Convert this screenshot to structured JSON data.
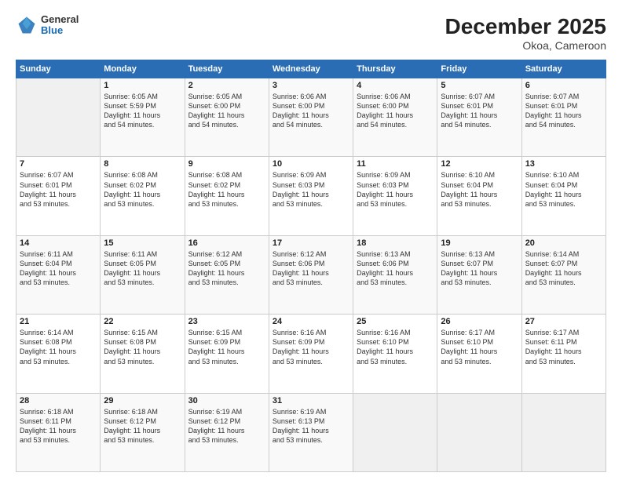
{
  "header": {
    "logo_general": "General",
    "logo_blue": "Blue",
    "title": "December 2025",
    "subtitle": "Okoa, Cameroon"
  },
  "columns": [
    "Sunday",
    "Monday",
    "Tuesday",
    "Wednesday",
    "Thursday",
    "Friday",
    "Saturday"
  ],
  "weeks": [
    [
      {
        "day": "",
        "info": ""
      },
      {
        "day": "1",
        "info": "Sunrise: 6:05 AM\nSunset: 5:59 PM\nDaylight: 11 hours\nand 54 minutes."
      },
      {
        "day": "2",
        "info": "Sunrise: 6:05 AM\nSunset: 6:00 PM\nDaylight: 11 hours\nand 54 minutes."
      },
      {
        "day": "3",
        "info": "Sunrise: 6:06 AM\nSunset: 6:00 PM\nDaylight: 11 hours\nand 54 minutes."
      },
      {
        "day": "4",
        "info": "Sunrise: 6:06 AM\nSunset: 6:00 PM\nDaylight: 11 hours\nand 54 minutes."
      },
      {
        "day": "5",
        "info": "Sunrise: 6:07 AM\nSunset: 6:01 PM\nDaylight: 11 hours\nand 54 minutes."
      },
      {
        "day": "6",
        "info": "Sunrise: 6:07 AM\nSunset: 6:01 PM\nDaylight: 11 hours\nand 54 minutes."
      }
    ],
    [
      {
        "day": "7",
        "info": "Sunrise: 6:07 AM\nSunset: 6:01 PM\nDaylight: 11 hours\nand 53 minutes."
      },
      {
        "day": "8",
        "info": "Sunrise: 6:08 AM\nSunset: 6:02 PM\nDaylight: 11 hours\nand 53 minutes."
      },
      {
        "day": "9",
        "info": "Sunrise: 6:08 AM\nSunset: 6:02 PM\nDaylight: 11 hours\nand 53 minutes."
      },
      {
        "day": "10",
        "info": "Sunrise: 6:09 AM\nSunset: 6:03 PM\nDaylight: 11 hours\nand 53 minutes."
      },
      {
        "day": "11",
        "info": "Sunrise: 6:09 AM\nSunset: 6:03 PM\nDaylight: 11 hours\nand 53 minutes."
      },
      {
        "day": "12",
        "info": "Sunrise: 6:10 AM\nSunset: 6:04 PM\nDaylight: 11 hours\nand 53 minutes."
      },
      {
        "day": "13",
        "info": "Sunrise: 6:10 AM\nSunset: 6:04 PM\nDaylight: 11 hours\nand 53 minutes."
      }
    ],
    [
      {
        "day": "14",
        "info": "Sunrise: 6:11 AM\nSunset: 6:04 PM\nDaylight: 11 hours\nand 53 minutes."
      },
      {
        "day": "15",
        "info": "Sunrise: 6:11 AM\nSunset: 6:05 PM\nDaylight: 11 hours\nand 53 minutes."
      },
      {
        "day": "16",
        "info": "Sunrise: 6:12 AM\nSunset: 6:05 PM\nDaylight: 11 hours\nand 53 minutes."
      },
      {
        "day": "17",
        "info": "Sunrise: 6:12 AM\nSunset: 6:06 PM\nDaylight: 11 hours\nand 53 minutes."
      },
      {
        "day": "18",
        "info": "Sunrise: 6:13 AM\nSunset: 6:06 PM\nDaylight: 11 hours\nand 53 minutes."
      },
      {
        "day": "19",
        "info": "Sunrise: 6:13 AM\nSunset: 6:07 PM\nDaylight: 11 hours\nand 53 minutes."
      },
      {
        "day": "20",
        "info": "Sunrise: 6:14 AM\nSunset: 6:07 PM\nDaylight: 11 hours\nand 53 minutes."
      }
    ],
    [
      {
        "day": "21",
        "info": "Sunrise: 6:14 AM\nSunset: 6:08 PM\nDaylight: 11 hours\nand 53 minutes."
      },
      {
        "day": "22",
        "info": "Sunrise: 6:15 AM\nSunset: 6:08 PM\nDaylight: 11 hours\nand 53 minutes."
      },
      {
        "day": "23",
        "info": "Sunrise: 6:15 AM\nSunset: 6:09 PM\nDaylight: 11 hours\nand 53 minutes."
      },
      {
        "day": "24",
        "info": "Sunrise: 6:16 AM\nSunset: 6:09 PM\nDaylight: 11 hours\nand 53 minutes."
      },
      {
        "day": "25",
        "info": "Sunrise: 6:16 AM\nSunset: 6:10 PM\nDaylight: 11 hours\nand 53 minutes."
      },
      {
        "day": "26",
        "info": "Sunrise: 6:17 AM\nSunset: 6:10 PM\nDaylight: 11 hours\nand 53 minutes."
      },
      {
        "day": "27",
        "info": "Sunrise: 6:17 AM\nSunset: 6:11 PM\nDaylight: 11 hours\nand 53 minutes."
      }
    ],
    [
      {
        "day": "28",
        "info": "Sunrise: 6:18 AM\nSunset: 6:11 PM\nDaylight: 11 hours\nand 53 minutes."
      },
      {
        "day": "29",
        "info": "Sunrise: 6:18 AM\nSunset: 6:12 PM\nDaylight: 11 hours\nand 53 minutes."
      },
      {
        "day": "30",
        "info": "Sunrise: 6:19 AM\nSunset: 6:12 PM\nDaylight: 11 hours\nand 53 minutes."
      },
      {
        "day": "31",
        "info": "Sunrise: 6:19 AM\nSunset: 6:13 PM\nDaylight: 11 hours\nand 53 minutes."
      },
      {
        "day": "",
        "info": ""
      },
      {
        "day": "",
        "info": ""
      },
      {
        "day": "",
        "info": ""
      }
    ]
  ]
}
